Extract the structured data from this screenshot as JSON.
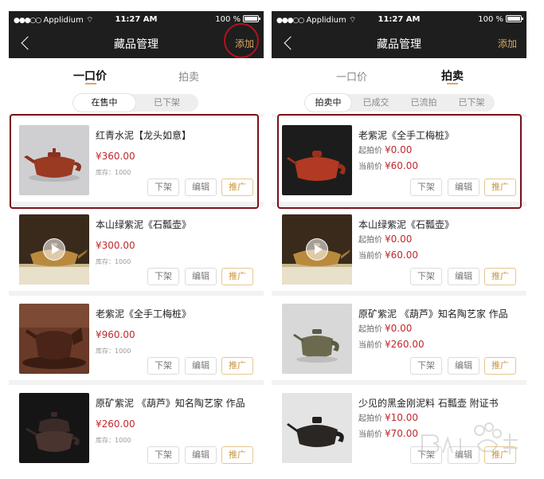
{
  "status": {
    "carrier": "Applidium",
    "time": "11:27 AM",
    "battery": "100 %"
  },
  "left": {
    "nav_title": "藏品管理",
    "nav_add": "添加",
    "tabs": [
      "一口价",
      "拍卖"
    ],
    "segments": [
      "在售中",
      "已下架"
    ],
    "stock_label": "库存：1000",
    "buttons": {
      "delist": "下架",
      "edit": "编辑",
      "promote": "推广"
    },
    "items": [
      {
        "title": "红青水泥【龙头如意】",
        "price": "¥360.00"
      },
      {
        "title": "本山绿紫泥《石瓢壶》",
        "price": "¥300.00"
      },
      {
        "title": "老紫泥《全手工梅桩》",
        "price": "¥960.00"
      },
      {
        "title": "原矿紫泥 《葫芦》知名陶艺家 作品",
        "price": "¥260.00"
      }
    ]
  },
  "right": {
    "nav_title": "藏品管理",
    "nav_add": "添加",
    "tabs": [
      "一口价",
      "拍卖"
    ],
    "segments": [
      "拍卖中",
      "已成交",
      "已流拍",
      "已下架"
    ],
    "start_label": "起拍价",
    "current_label": "当前价",
    "buttons": {
      "delist": "下架",
      "edit": "编辑",
      "promote": "推广"
    },
    "items": [
      {
        "title": "老紫泥《全手工梅桩》",
        "start": "¥0.00",
        "current": "¥60.00"
      },
      {
        "title": "本山绿紫泥《石瓢壶》",
        "start": "¥0.00",
        "current": "¥60.00"
      },
      {
        "title": "原矿紫泥 《葫芦》知名陶艺家 作品",
        "start": "¥0.00",
        "current": "¥260.00"
      },
      {
        "title": "少见的黑金刚泥料  石瓢壶 附证书",
        "start": "¥10.00",
        "current": "¥70.00"
      }
    ]
  },
  "colors": {
    "accent": "#d6a864",
    "price": "#c0282d",
    "highlight": "#7a1018",
    "navbar": "#1e1e1e"
  }
}
